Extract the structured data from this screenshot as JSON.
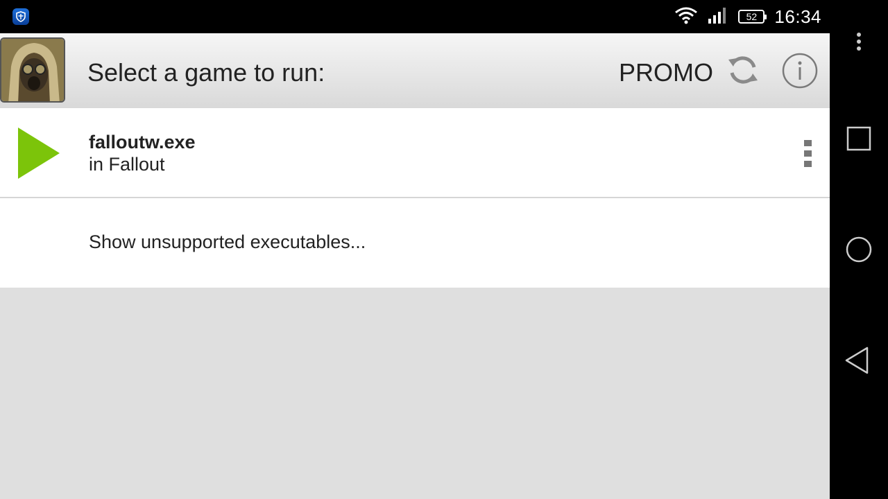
{
  "status_bar": {
    "app_icon": "shield-icon",
    "wifi_icon": "wifi-icon",
    "signal_icon": "signal-icon",
    "battery_level": "52",
    "time": "16:34"
  },
  "app_bar": {
    "avatar_icon": "gasmask-avatar-icon",
    "title": "Select a game to run:",
    "promo_label": "PROMO",
    "refresh_icon": "refresh-icon",
    "info_icon": "info-icon"
  },
  "games": [
    {
      "icon": "play-icon",
      "name": "falloutw.exe",
      "location": "in Fallout",
      "menu_icon": "more-vertical-icon"
    }
  ],
  "show_unsupported_label": "Show unsupported executables...",
  "nav_bar": {
    "overflow_icon": "more-vertical-icon",
    "recents_icon": "square-icon",
    "home_icon": "circle-icon",
    "back_icon": "triangle-back-icon"
  },
  "colors": {
    "accent_play": "#7cc40a",
    "app_bar_top": "#f6f6f6",
    "app_bar_bottom": "#d9d9d9",
    "content_bg": "#dfdfdf"
  }
}
